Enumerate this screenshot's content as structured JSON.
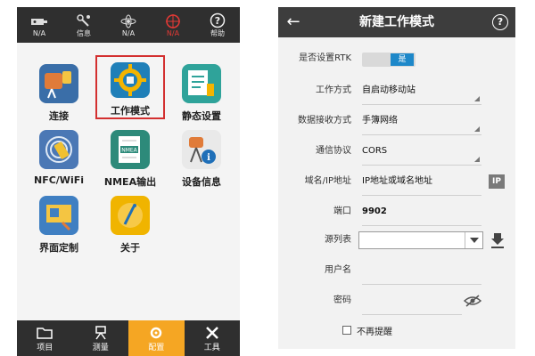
{
  "left_screen": {
    "status_bar": [
      {
        "label": "N/A",
        "icon": "device-icon"
      },
      {
        "label": "信息",
        "icon": "satellite-info-icon"
      },
      {
        "label": "N/A",
        "icon": "network-icon"
      },
      {
        "label": "N/A",
        "icon": "target-icon"
      },
      {
        "label": "帮助",
        "icon": "help-icon"
      }
    ],
    "tiles": [
      {
        "label": "连接",
        "icon": "connect-icon"
      },
      {
        "label": "工作模式",
        "icon": "work-mode-icon"
      },
      {
        "label": "静态设置",
        "icon": "static-settings-icon"
      },
      {
        "label": "NFC/WiFi",
        "icon": "nfc-wifi-icon"
      },
      {
        "label": "NMEA输出",
        "icon": "nmea-output-icon"
      },
      {
        "label": "设备信息",
        "icon": "device-info-icon"
      },
      {
        "label": "界面定制",
        "icon": "ui-customize-icon"
      },
      {
        "label": "关于",
        "icon": "about-icon"
      }
    ],
    "bottom_nav": [
      {
        "label": "项目",
        "icon": "folder-icon"
      },
      {
        "label": "测量",
        "icon": "survey-icon"
      },
      {
        "label": "配置",
        "icon": "settings-gear-icon"
      },
      {
        "label": "工具",
        "icon": "tools-icon"
      }
    ],
    "colors": {
      "active_tab": "#f5a623",
      "selected_border": "#d32f2f",
      "bar": "#2f2f2f"
    }
  },
  "right_screen": {
    "title": "新建工作模式",
    "rtk": {
      "label": "是否设置RTK",
      "value": "是"
    },
    "work_method": {
      "label": "工作方式",
      "value": "自启动移动站"
    },
    "data_receive": {
      "label": "数据接收方式",
      "value": "手簿网络"
    },
    "protocol": {
      "label": "通信协议",
      "value": "CORS"
    },
    "domain": {
      "label": "域名/IP地址",
      "placeholder": "IP地址或域名地址",
      "button": "IP"
    },
    "port": {
      "label": "端口",
      "value": "9902"
    },
    "source_list": {
      "label": "源列表",
      "value": ""
    },
    "username": {
      "label": "用户名",
      "value": ""
    },
    "password": {
      "label": "密码",
      "value": ""
    },
    "no_remind": {
      "label": "不再提醒"
    },
    "colors": {
      "toggle_on": "#1e88c9",
      "appbar": "#3d3d3d"
    }
  }
}
